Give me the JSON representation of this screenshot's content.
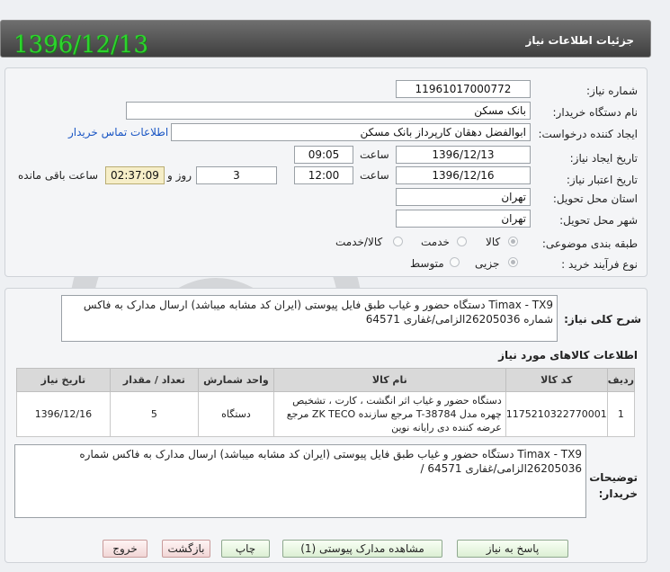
{
  "header": {
    "title": "جزئیات اطلاعات نیاز",
    "date": "1396/12/13"
  },
  "form": {
    "need_number": {
      "label": "شماره نیاز:",
      "value": "11961017000772"
    },
    "buyer_org": {
      "label": "نام دستگاه خریدار:",
      "value": "بانک مسکن"
    },
    "requester": {
      "label": "ایجاد کننده درخواست:",
      "value": "ابوالفضل دهقان کارپرداز بانک مسکن",
      "contact_link": "اطلاعات تماس خریدار"
    },
    "created": {
      "label": "تاریخ ایجاد نیاز:",
      "date": "1396/12/13",
      "time_label": "ساعت",
      "time": "09:05"
    },
    "validity": {
      "label": "تاریخ اعتبار نیاز:",
      "date": "1396/12/16",
      "time_label": "ساعت",
      "time": "12:00",
      "days": "3",
      "days_label": "روز و",
      "remaining": "02:37:09",
      "remaining_label": "ساعت باقی مانده"
    },
    "province": {
      "label": "استان محل تحویل:",
      "value": "تهران"
    },
    "city": {
      "label": "شهر محل تحویل:",
      "value": "تهران"
    },
    "category": {
      "label": "طبقه بندی موضوعی:",
      "options": [
        "کالا",
        "خدمت",
        "کالا/خدمت"
      ],
      "selected": "کالا"
    },
    "process": {
      "label": "نوع فرآیند خرید :",
      "options": [
        "جزیی",
        "متوسط"
      ],
      "selected": "جزیی"
    }
  },
  "summary": {
    "label": "شرح کلی نیاز:",
    "text": "Timax - TX9 دستگاه حضور و غیاب طبق فایل پیوستی (ایران کد مشابه میباشد) ارسال مدارک به فاکس شماره 26205036الزامی/غفاری 64571"
  },
  "items": {
    "title": "اطلاعات کالاهای مورد نیاز",
    "columns": [
      "ردیف",
      "کد کالا",
      "نام کالا",
      "واحد شمارش",
      "تعداد / مقدار",
      "تاریخ نیاز"
    ],
    "rows": [
      {
        "row": "1",
        "code": "1175210322770001",
        "name": "دستگاه حضور و غیاب اثر انگشت ، کارت ، تشخیص چهره مدل T-38784 مرجع سازنده ZK TECO مرجع عرضه کننده دی رایانه نوین",
        "unit": "دستگاه",
        "qty": "5",
        "date": "1396/12/16"
      }
    ]
  },
  "buyer_notes": {
    "label": "توضیحات خریدار:",
    "text": "Timax - TX9 دستگاه حضور و غیاب طبق فایل پیوستی (ایران کد مشابه میباشد) ارسال مدارک به فاکس شماره 26205036الزامی/غفاری 64571 /"
  },
  "buttons": {
    "respond": "پاسخ به نیاز",
    "attachments": "مشاهده مدارک پیوستی (1)",
    "print": "چاپ",
    "back": "بازگشت",
    "exit": "خروج"
  },
  "colors": {
    "header_bg": "#4f4f4f",
    "date_green": "#2dd42d",
    "link_blue": "#1a56c4",
    "timer_bg": "#f6eec8"
  }
}
